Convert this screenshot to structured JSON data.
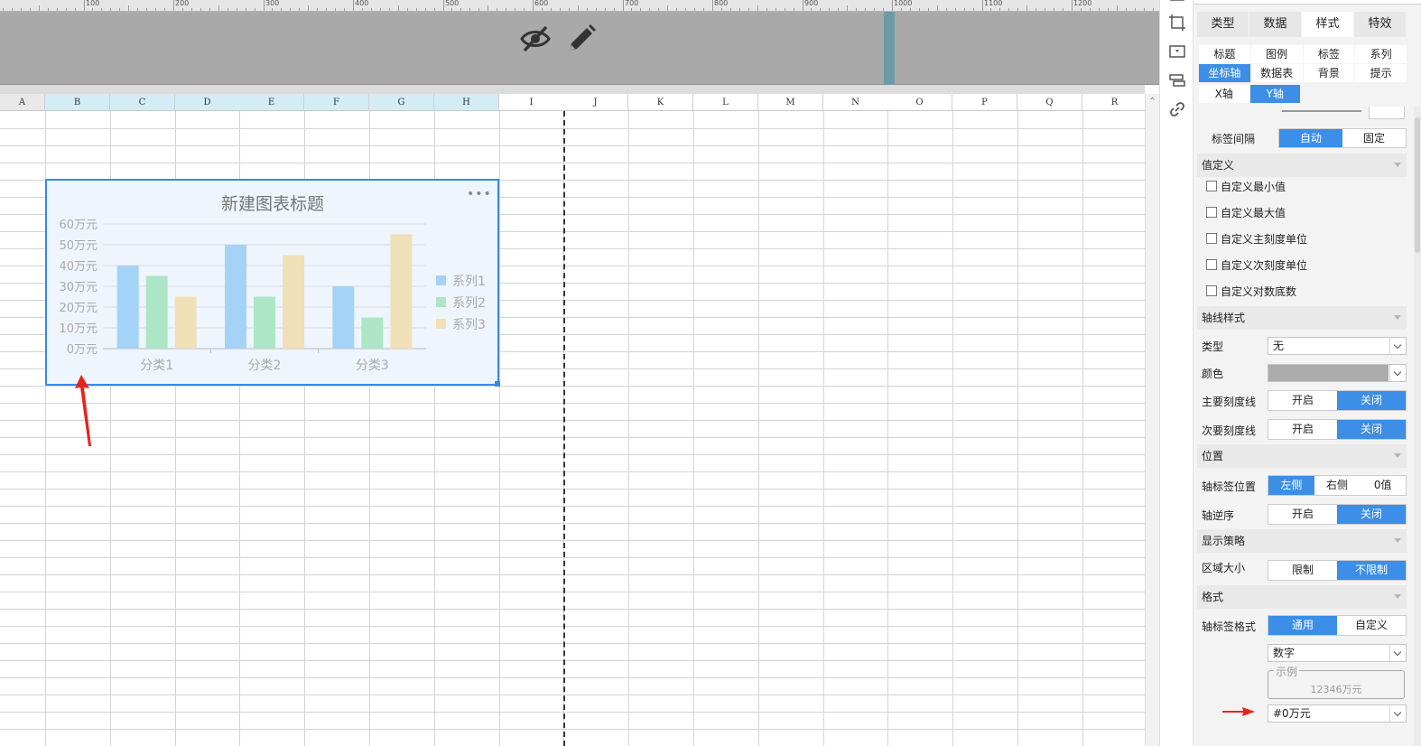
{
  "ruler": {
    "labels": [
      "100",
      "200",
      "300",
      "400",
      "500",
      "600",
      "700",
      "800",
      "900",
      "1000",
      "1100",
      "1200"
    ]
  },
  "header": {
    "icons": [
      "eye-off-icon",
      "pencil-icon"
    ]
  },
  "columns": [
    "A",
    "B",
    "C",
    "D",
    "E",
    "F",
    "G",
    "H",
    "I",
    "J",
    "K",
    "L",
    "M",
    "N",
    "O",
    "P",
    "Q",
    "R"
  ],
  "selected_columns": [
    "B",
    "C",
    "D",
    "E",
    "F",
    "G",
    "H"
  ],
  "chart": {
    "more_label": "•••"
  },
  "chart_data": {
    "type": "bar",
    "title": "新建图表标题",
    "categories": [
      "分类1",
      "分类2",
      "分类3"
    ],
    "series": [
      {
        "name": "系列1",
        "color": "#a5d3f8",
        "values": [
          40,
          50,
          30
        ]
      },
      {
        "name": "系列2",
        "color": "#ace6c6",
        "values": [
          35,
          25,
          15
        ]
      },
      {
        "name": "系列3",
        "color": "#f0e0b8",
        "values": [
          25,
          45,
          55
        ]
      }
    ],
    "y_ticks": [
      "0万元",
      "10万元",
      "20万元",
      "30万元",
      "40万元",
      "50万元",
      "60万元"
    ],
    "ylim": [
      0,
      60
    ],
    "grid": true,
    "legend_position": "right"
  },
  "panel": {
    "main_tabs": [
      {
        "label": "类型",
        "active": false
      },
      {
        "label": "数据",
        "active": false
      },
      {
        "label": "样式",
        "active": true
      },
      {
        "label": "特效",
        "active": false
      }
    ],
    "sub_tabs": [
      {
        "label": "标题",
        "active": false
      },
      {
        "label": "图例",
        "active": false
      },
      {
        "label": "标签",
        "active": false
      },
      {
        "label": "系列",
        "active": false
      },
      {
        "label": "坐标轴",
        "active": true
      },
      {
        "label": "数据表",
        "active": false
      },
      {
        "label": "背景",
        "active": false
      },
      {
        "label": "提示",
        "active": false
      }
    ],
    "axis_tabs": [
      {
        "label": "X轴",
        "active": false
      },
      {
        "label": "Y轴",
        "active": true
      }
    ],
    "label_interval": {
      "label": "标签间隔",
      "options": [
        "自动",
        "固定"
      ],
      "selected": "自动"
    },
    "value_define": {
      "title": "值定义",
      "checkboxes": [
        "自定义最小值",
        "自定义最大值",
        "自定义主刻度单位",
        "自定义次刻度单位",
        "自定义对数底数"
      ]
    },
    "axis_style": {
      "title": "轴线样式",
      "type_label": "类型",
      "type_value": "无",
      "color_label": "颜色",
      "color_value": "#acacac",
      "major_tick": {
        "label": "主要刻度线",
        "options": [
          "开启",
          "关闭"
        ],
        "selected": "关闭"
      },
      "minor_tick": {
        "label": "次要刻度线",
        "options": [
          "开启",
          "关闭"
        ],
        "selected": "关闭"
      }
    },
    "position": {
      "title": "位置",
      "label_position": {
        "label": "轴标签位置",
        "options": [
          "左侧",
          "右侧",
          "0值"
        ],
        "selected": "左侧"
      },
      "reverse": {
        "label": "轴逆序",
        "options": [
          "开启",
          "关闭"
        ],
        "selected": "关闭"
      }
    },
    "display_strategy": {
      "title": "显示策略",
      "area_size": {
        "label": "区域大小",
        "options": [
          "限制",
          "不限制"
        ],
        "selected": "不限制"
      }
    },
    "format": {
      "title": "格式",
      "label_format": {
        "label": "轴标签格式",
        "options": [
          "通用",
          "自定义"
        ],
        "selected": "通用"
      },
      "number_type": "数字",
      "example_legend": "示例",
      "example_value": "12346万元",
      "format_string": "#0万元"
    }
  },
  "colors": {
    "accent": "#3c8ee6",
    "chart_border": "#3a87e6",
    "arrow": "#e8231a"
  }
}
